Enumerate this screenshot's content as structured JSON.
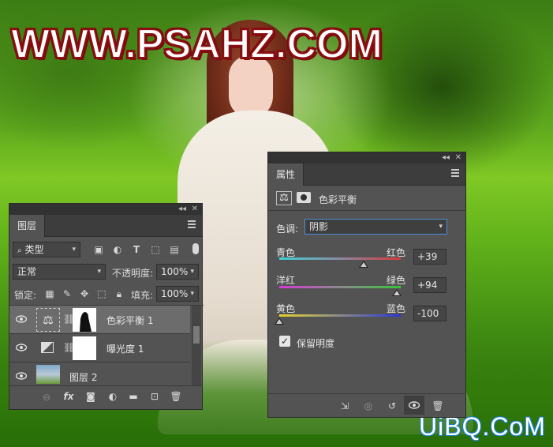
{
  "watermarks": {
    "top": "WWW.PSAHZ.COM",
    "bottom": "UiBQ.CoM"
  },
  "layers_panel": {
    "tab": "图层",
    "filter_kind": "类型",
    "blend_mode": "正常",
    "opacity_label": "不透明度:",
    "opacity_value": "100%",
    "lock_label": "锁定:",
    "fill_label": "填充:",
    "fill_value": "100%",
    "layers": [
      {
        "name": "色彩平衡 1",
        "selected": true
      },
      {
        "name": "曝光度 1",
        "selected": false
      },
      {
        "name": "图层 2",
        "selected": false
      }
    ]
  },
  "properties_panel": {
    "tab": "属性",
    "title": "色彩平衡",
    "tone_label": "色调:",
    "tone_value": "阴影",
    "sliders": [
      {
        "left": "青色",
        "right": "红色",
        "value": "+39",
        "number": 39,
        "colors": [
          "#3fd3d9",
          "#d63a3a"
        ]
      },
      {
        "left": "洋红",
        "right": "绿色",
        "value": "+94",
        "number": 94,
        "colors": [
          "#d63ad6",
          "#37c43a"
        ]
      },
      {
        "left": "黄色",
        "right": "蓝色",
        "value": "-100",
        "number": -100,
        "colors": [
          "#e3d22a",
          "#2a36d6"
        ]
      }
    ],
    "preserve_label": "保留明度",
    "preserve_checked": true
  }
}
